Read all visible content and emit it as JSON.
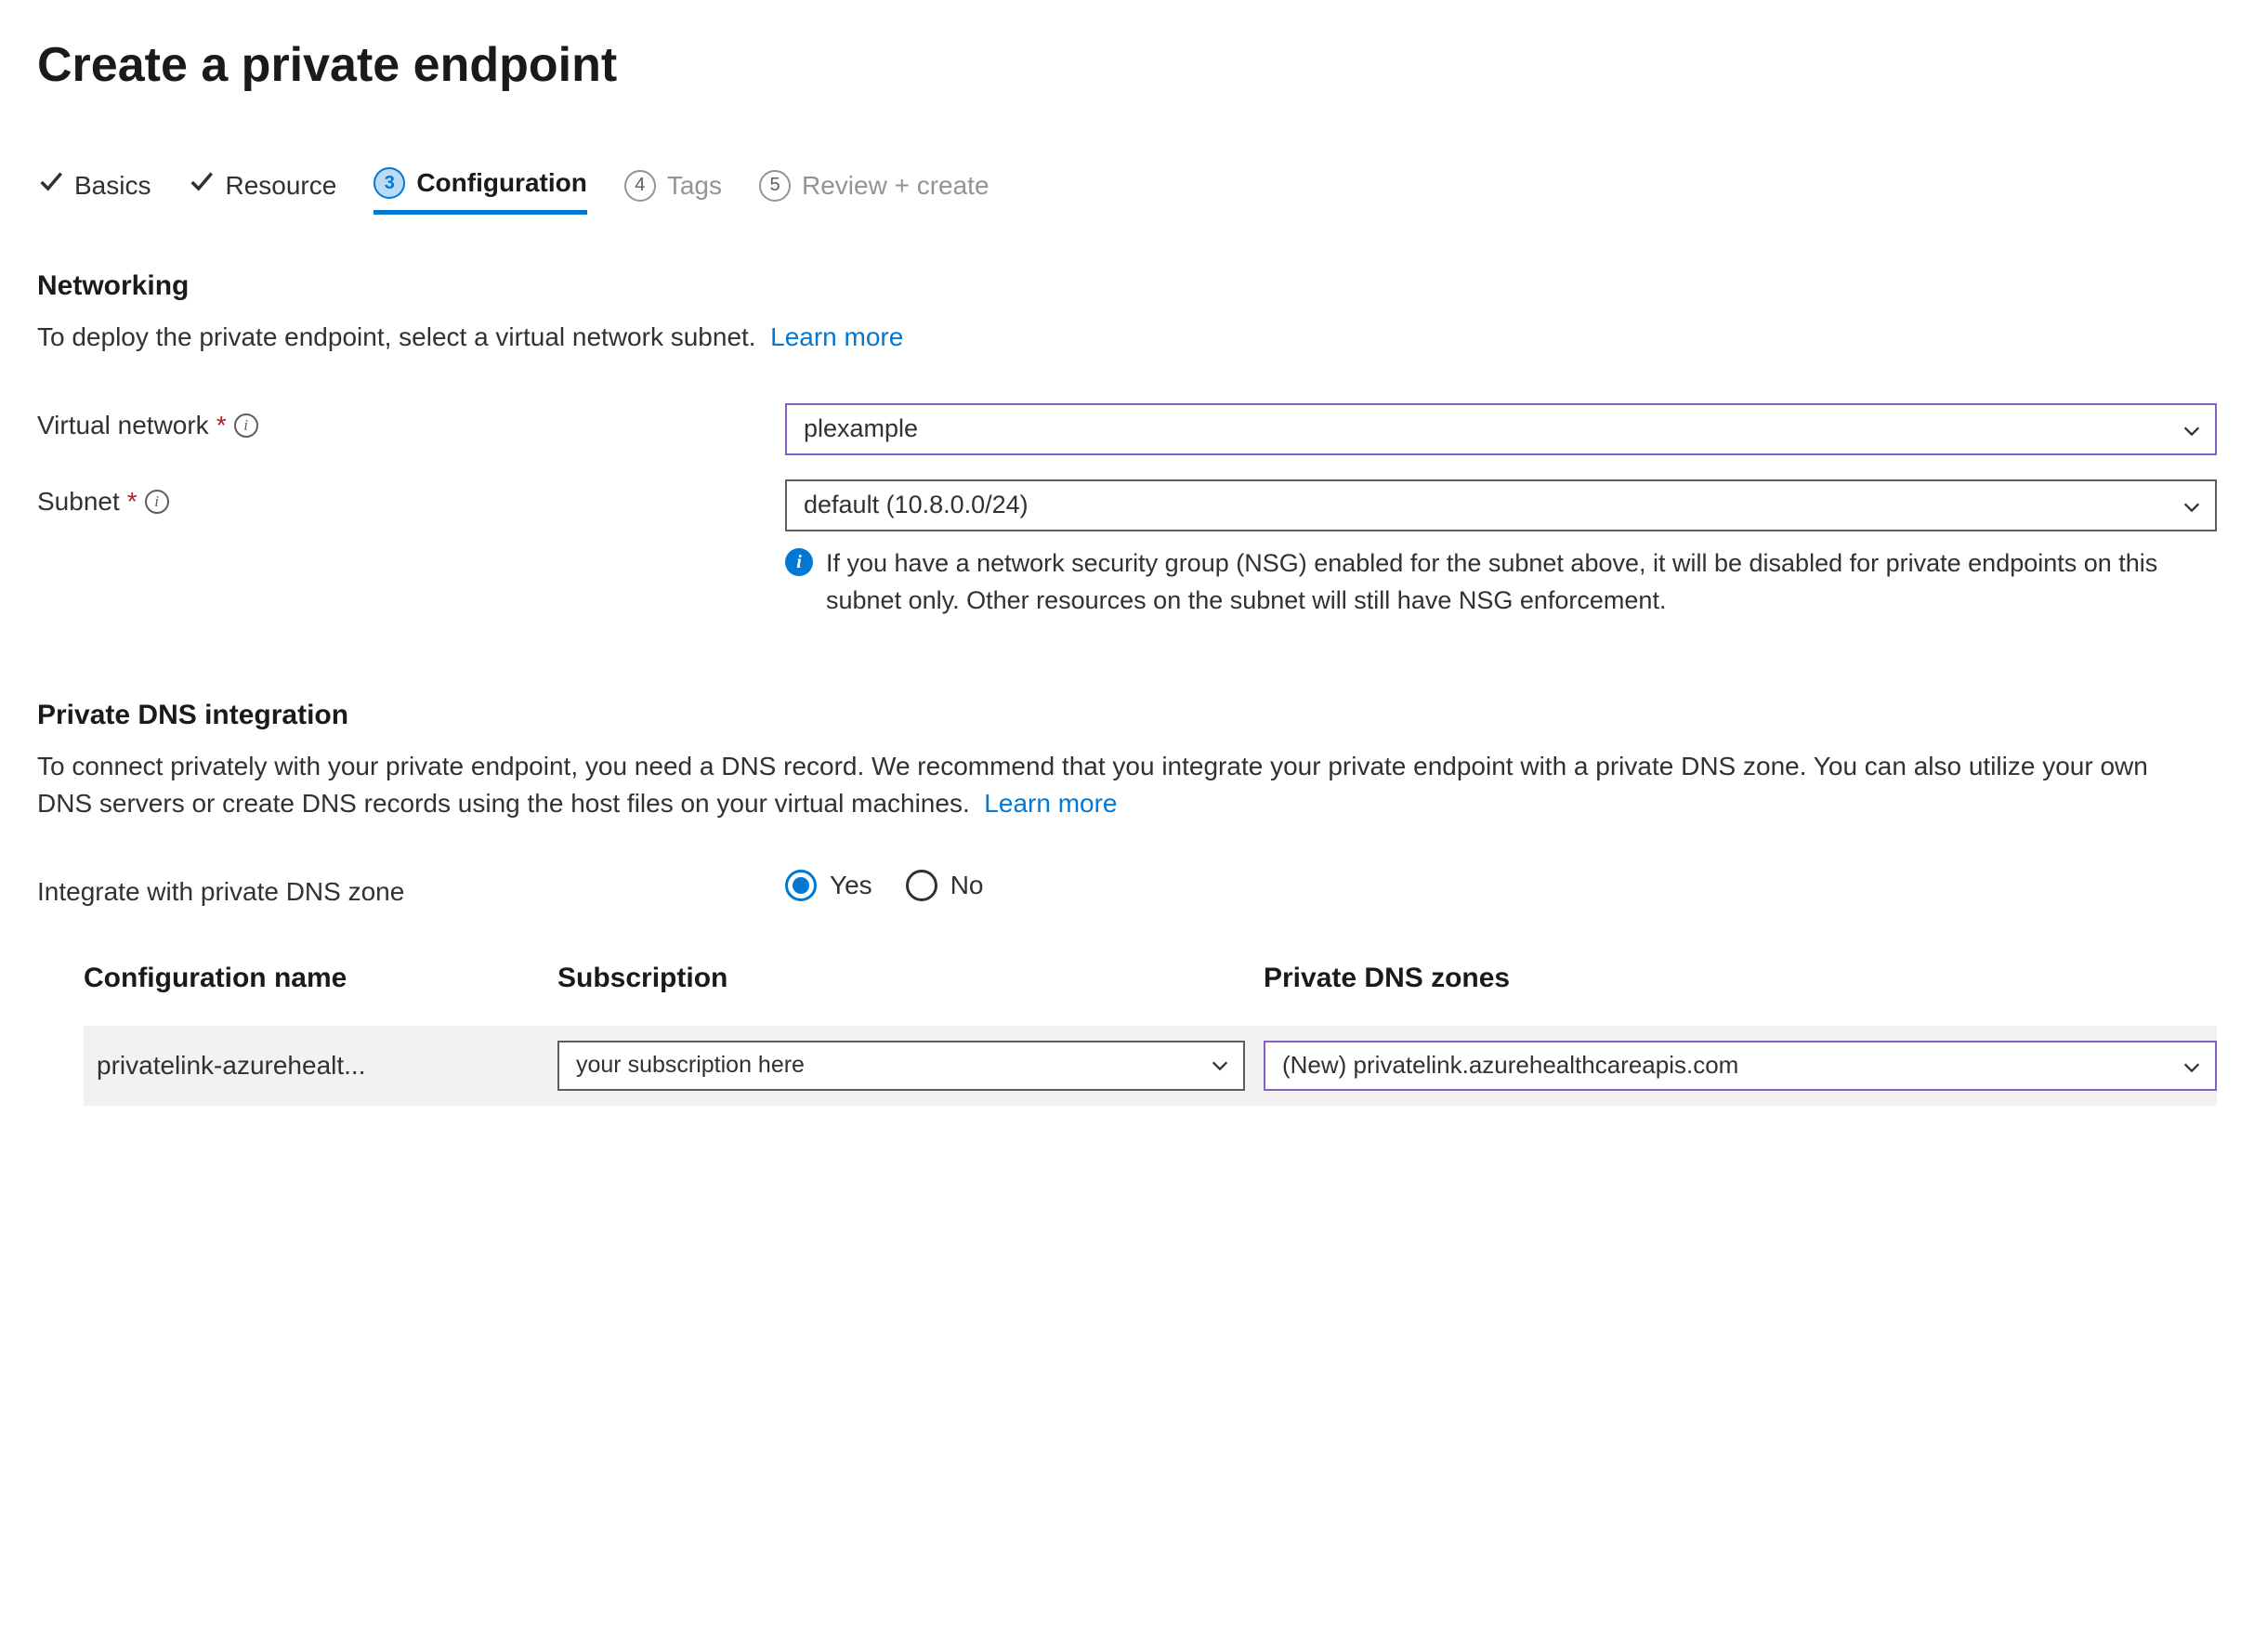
{
  "page_title": "Create a private endpoint",
  "tabs": [
    {
      "label": "Basics",
      "state": "done"
    },
    {
      "label": "Resource",
      "state": "done"
    },
    {
      "label": "Configuration",
      "state": "active",
      "step": "3"
    },
    {
      "label": "Tags",
      "state": "pending",
      "step": "4"
    },
    {
      "label": "Review + create",
      "state": "pending",
      "step": "5"
    }
  ],
  "networking": {
    "heading": "Networking",
    "desc": "To deploy the private endpoint, select a virtual network subnet.",
    "learn_more": "Learn more",
    "vnet_label": "Virtual network",
    "vnet_value": "plexample",
    "subnet_label": "Subnet",
    "subnet_value": "default (10.8.0.0/24)",
    "nsg_note": "If you have a network security group (NSG) enabled for the subnet above, it will be disabled for private endpoints on this subnet only. Other resources on the subnet will still have NSG enforcement."
  },
  "dns": {
    "heading": "Private DNS integration",
    "desc": "To connect privately with your private endpoint, you need a DNS record. We recommend that you integrate your private endpoint with a private DNS zone. You can also utilize your own DNS servers or create DNS records using the host files on your virtual machines.",
    "learn_more": "Learn more",
    "integrate_label": "Integrate with private DNS zone",
    "yes_label": "Yes",
    "no_label": "No",
    "integrate_value": "yes",
    "table": {
      "col_config": "Configuration name",
      "col_subscription": "Subscription",
      "col_zones": "Private DNS zones",
      "rows": [
        {
          "config_name": "privatelink-azurehealt...",
          "subscription": "your subscription here",
          "zone": "(New) privatelink.azurehealthcareapis.com"
        }
      ]
    }
  }
}
